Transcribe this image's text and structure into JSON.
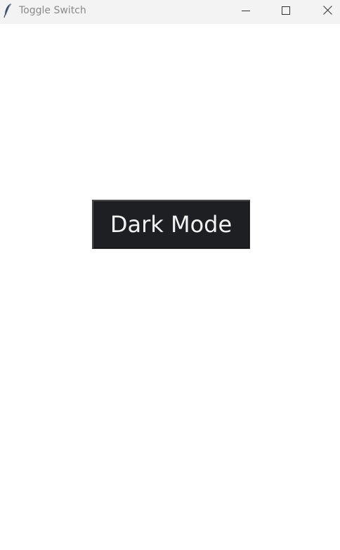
{
  "window": {
    "title": "Toggle Switch",
    "controls": {
      "minimize_icon": "minimize-icon",
      "maximize_icon": "maximize-icon",
      "close_icon": "close-icon"
    },
    "app_icon": "feather-icon"
  },
  "main": {
    "toggle_button_label": "Dark Mode",
    "button_bg": "#1e1f22",
    "button_fg": "#f2f2f2"
  }
}
